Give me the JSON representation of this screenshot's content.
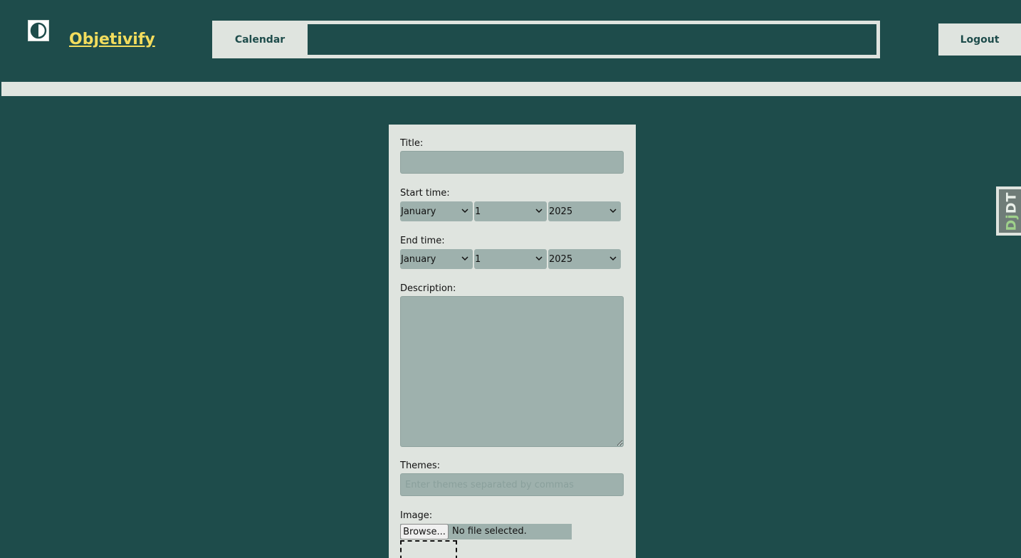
{
  "header": {
    "brand": "Objetivify",
    "nav": {
      "calendar_label": "Calendar"
    },
    "logout_label": "Logout"
  },
  "form": {
    "title_label": "Title:",
    "title_value": "",
    "start_label": "Start time:",
    "start": {
      "month": "January",
      "day": "1",
      "year": "2025"
    },
    "end_label": "End time:",
    "end": {
      "month": "January",
      "day": "1",
      "year": "2025"
    },
    "description_label": "Description:",
    "description_value": "",
    "themes_label": "Themes:",
    "themes_placeholder": "Enter themes separated by commas",
    "image_label": "Image:",
    "browse_label": "Browse...",
    "file_status": "No file selected."
  },
  "debug_toolbar": {
    "prefix": "Dj",
    "suffix": "DT"
  },
  "colors": {
    "background": "#1e4c4b",
    "panel": "#dfe4df",
    "field": "#9eb1ad",
    "brand": "#f2dc5d"
  }
}
